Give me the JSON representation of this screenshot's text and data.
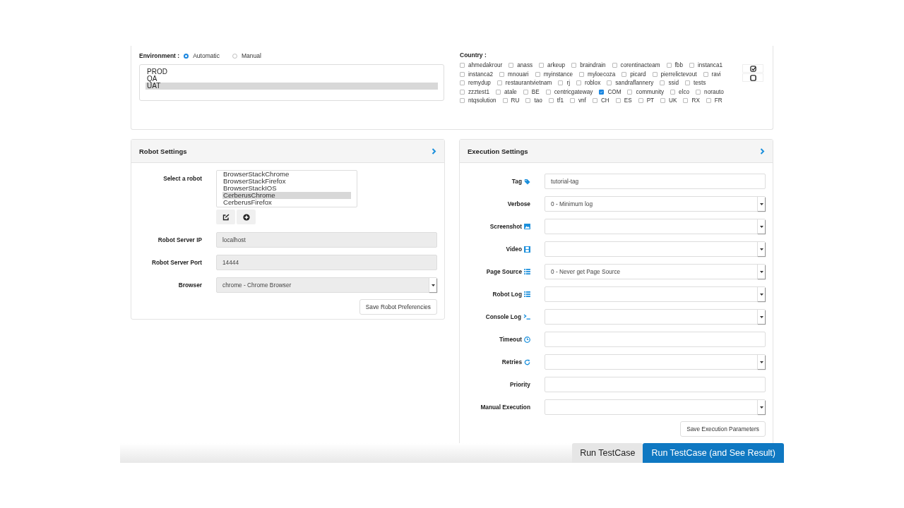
{
  "environment": {
    "label": "Environment :",
    "modes": [
      {
        "label": "Automatic",
        "selected": true
      },
      {
        "label": "Manual",
        "selected": false
      }
    ],
    "options": [
      {
        "label": "PROD",
        "selected": false
      },
      {
        "label": "QA",
        "selected": false
      },
      {
        "label": "UAT",
        "selected": true
      }
    ]
  },
  "country": {
    "label": "Country :",
    "items": [
      {
        "label": "ahmedakrour",
        "checked": false
      },
      {
        "label": "anass",
        "checked": false
      },
      {
        "label": "arkeup",
        "checked": false
      },
      {
        "label": "braindrain",
        "checked": false
      },
      {
        "label": "corentinacteam",
        "checked": false
      },
      {
        "label": "fbb",
        "checked": false
      },
      {
        "label": "instanca1",
        "checked": false
      },
      {
        "label": "instanca2",
        "checked": false
      },
      {
        "label": "mnouari",
        "checked": false
      },
      {
        "label": "myinstance",
        "checked": false
      },
      {
        "label": "myloecoza",
        "checked": false
      },
      {
        "label": "picard",
        "checked": false
      },
      {
        "label": "pierrelictevout",
        "checked": false
      },
      {
        "label": "ravi",
        "checked": false
      },
      {
        "label": "remydup",
        "checked": false
      },
      {
        "label": "restaurantvietnam",
        "checked": false
      },
      {
        "label": "rj",
        "checked": false
      },
      {
        "label": "roblox",
        "checked": false
      },
      {
        "label": "sandraflannery",
        "checked": false
      },
      {
        "label": "ssid",
        "checked": false
      },
      {
        "label": "tests",
        "checked": false
      },
      {
        "label": "zzztest1",
        "checked": false
      },
      {
        "label": "atale",
        "checked": false
      },
      {
        "label": "BE",
        "checked": false
      },
      {
        "label": "centricgateway",
        "checked": false
      },
      {
        "label": "COM",
        "checked": true
      },
      {
        "label": "community",
        "checked": false
      },
      {
        "label": "elco",
        "checked": false
      },
      {
        "label": "norauto",
        "checked": false
      },
      {
        "label": "ntqsolution",
        "checked": false
      },
      {
        "label": "RU",
        "checked": false
      },
      {
        "label": "tao",
        "checked": false
      },
      {
        "label": "tf1",
        "checked": false
      },
      {
        "label": "vnf",
        "checked": false
      },
      {
        "label": "CH",
        "checked": false
      },
      {
        "label": "ES",
        "checked": false
      },
      {
        "label": "PT",
        "checked": false
      },
      {
        "label": "UK",
        "checked": false
      },
      {
        "label": "RX",
        "checked": false
      },
      {
        "label": "FR",
        "checked": false
      }
    ]
  },
  "robot_settings": {
    "title": "Robot Settings",
    "select_label": "Select a robot",
    "robots": [
      {
        "label": "BrowserStackChrome",
        "selected": false
      },
      {
        "label": "BrowserStackFirefox",
        "selected": false
      },
      {
        "label": "BrowserStackIOS",
        "selected": false
      },
      {
        "label": "CerberusChrome",
        "selected": true
      },
      {
        "label": "CerberusFirefox",
        "selected": false
      }
    ],
    "fields": [
      {
        "label": "Robot Server IP",
        "kind": "text",
        "value": "localhost",
        "disabled": true
      },
      {
        "label": "Robot Server Port",
        "kind": "text",
        "value": "14444",
        "disabled": true
      },
      {
        "label": "Browser",
        "kind": "select",
        "value": "chrome - Chrome Browser",
        "disabled": true
      }
    ],
    "save_button": "Save Robot Preferencies"
  },
  "execution_settings": {
    "title": "Execution Settings",
    "fields": [
      {
        "label": "Tag",
        "kind": "text",
        "value": "tutorial-tag"
      },
      {
        "label": "Verbose",
        "kind": "select",
        "value": "0 - Minimum log"
      },
      {
        "label": "Screenshot",
        "kind": "select"
      },
      {
        "label": "Video",
        "kind": "select"
      },
      {
        "label": "Page Source",
        "kind": "select",
        "value": "0 - Never get Page Source"
      },
      {
        "label": "Robot Log",
        "kind": "select"
      },
      {
        "label": "Console Log",
        "kind": "select"
      },
      {
        "label": "Timeout",
        "kind": "text"
      },
      {
        "label": "Retries",
        "kind": "select"
      },
      {
        "label": "Priority",
        "kind": "text"
      },
      {
        "label": "Manual Execution",
        "kind": "select"
      }
    ],
    "save_button": "Save Execution Parameters"
  },
  "footer_buttons": [
    {
      "label": "Run TestCase",
      "kind": "secondary"
    },
    {
      "label": "Run TestCase (and See Result)",
      "kind": "primary"
    }
  ]
}
